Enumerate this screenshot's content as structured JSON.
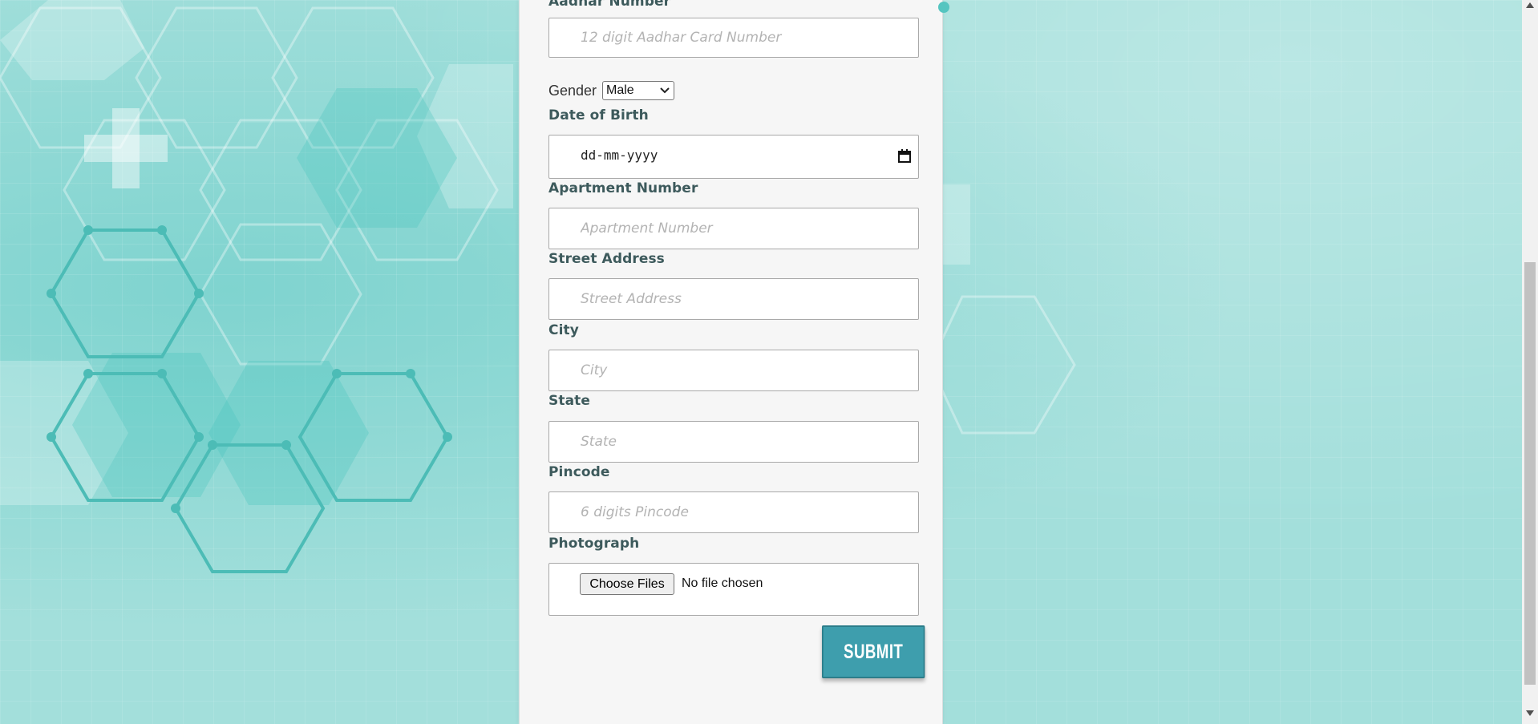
{
  "form": {
    "aadhar": {
      "label": "Aadhar Number",
      "placeholder": "12 digit Aadhar Card Number"
    },
    "gender": {
      "label": "Gender",
      "selected": "Male"
    },
    "dob": {
      "label": "Date of Birth",
      "placeholder": "dd-mm-yyyy"
    },
    "apartment": {
      "label": "Apartment Number",
      "placeholder": "Apartment Number"
    },
    "street": {
      "label": "Street Address",
      "placeholder": "Street Address"
    },
    "city": {
      "label": "City",
      "placeholder": "City"
    },
    "state": {
      "label": "State",
      "placeholder": "State"
    },
    "pincode": {
      "label": "Pincode",
      "placeholder": "6 digits Pincode"
    },
    "photo": {
      "label": "Photograph",
      "button_label": "Choose Files",
      "status": "No file chosen"
    },
    "submit_label": "SUBMIT"
  },
  "icons": {
    "date_picker": "calendar-icon",
    "select_arrow": "chevron-down-icon",
    "scroll_up": "triangle-up-icon",
    "scroll_down": "triangle-down-icon"
  },
  "colors": {
    "background": "#a3dfdb",
    "panel": "#f6f6f6",
    "submit": "#3e9ead",
    "label": "#3d5a5c"
  },
  "scroll": {
    "thumb_fraction": 0.58,
    "position_fraction": 1.0
  }
}
